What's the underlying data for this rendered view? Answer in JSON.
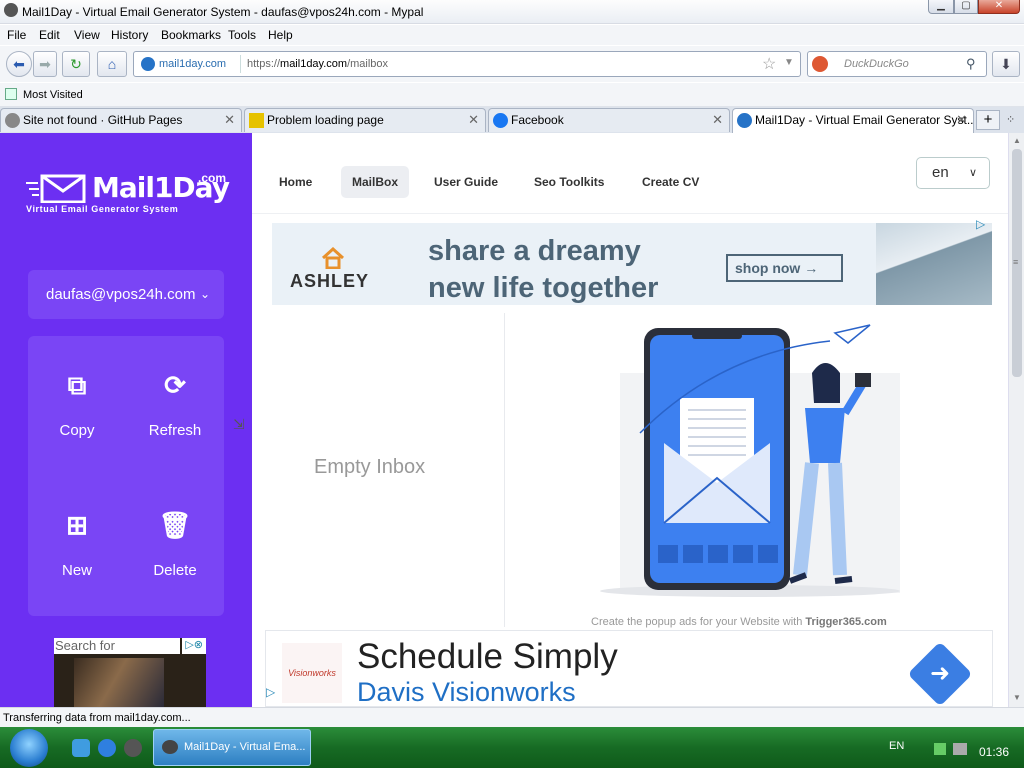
{
  "window": {
    "title": "Mail1Day - Virtual Email Generator System - daufas@vpos24h.com - Mypal"
  },
  "menu": {
    "items": [
      "File",
      "Edit",
      "View",
      "History",
      "Bookmarks",
      "Tools",
      "Help"
    ]
  },
  "navbar": {
    "site_identity": "mail1day.com",
    "url_prefix": "https://",
    "url_host": "mail1day.com",
    "url_path": "/mailbox",
    "search_placeholder": "DuckDuckGo"
  },
  "bookmarks": {
    "most_visited": "Most Visited"
  },
  "tabs": [
    {
      "label": "Site not found · GitHub Pages",
      "active": false
    },
    {
      "label": "Problem loading page",
      "active": false
    },
    {
      "label": "Facebook",
      "active": false
    },
    {
      "label": "Mail1Day - Virtual Email Generator Syst...",
      "active": true
    }
  ],
  "logo": {
    "name": "Mail1Day",
    "tld": ".com",
    "tagline": "Virtual Email Generator System"
  },
  "sidebar": {
    "email": "daufas@vpos24h.com",
    "actions": {
      "copy": "Copy",
      "refresh": "Refresh",
      "new": "New",
      "delete": "Delete"
    },
    "ad_search": "Search for"
  },
  "nav": {
    "home": "Home",
    "mailbox": "MailBox",
    "guide": "User Guide",
    "seo": "Seo Toolkits",
    "cv": "Create CV",
    "language": "en"
  },
  "banner_ad": {
    "brand": "ASHLEY",
    "headline_1": "share a dreamy",
    "headline_2": "new life together",
    "cta": "shop now →"
  },
  "inbox": {
    "empty": "Empty Inbox"
  },
  "popup_credit": {
    "text": "Create the popup ads for your Website with ",
    "brand": "Trigger365.com"
  },
  "bottom_ad": {
    "logo": "Visionworks",
    "title": "Schedule Simply",
    "subtitle": "Davis Visionworks"
  },
  "status": {
    "text": "Transferring data from mail1day.com..."
  },
  "taskbar": {
    "task": "Mail1Day - Virtual Ema...",
    "language": "EN",
    "clock": "01:36"
  },
  "colors": {
    "sidebar": "#6c2ff2",
    "sidebar_tile": "#7a45f5",
    "ad_text": "#4d6577",
    "link_blue": "#1f6fc5"
  }
}
